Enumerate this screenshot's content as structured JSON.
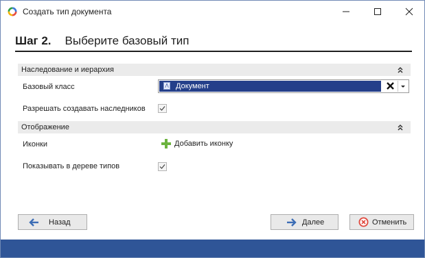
{
  "window": {
    "title": "Создать тип документа",
    "minimize_icon": "minimize-icon",
    "maximize_icon": "maximize-icon",
    "close_icon": "close-icon",
    "accent_color": "#2f5597"
  },
  "step": {
    "number": "Шаг 2.",
    "title": "Выберите базовый тип"
  },
  "groups": {
    "inheritance": {
      "title": "Наследование и иерархия",
      "base_class_label": "Базовый класс",
      "base_class_value": "Документ",
      "allow_children_label": "Разрешать создавать наследников",
      "allow_children_checked": true
    },
    "display": {
      "title": "Отображение",
      "icons_label": "Иконки",
      "add_icon_label": "Добавить иконку",
      "show_in_tree_label": "Показывать в дереве типов",
      "show_in_tree_checked": true
    }
  },
  "buttons": {
    "back": "Назад",
    "next": "Далее",
    "cancel": "Отменить"
  }
}
